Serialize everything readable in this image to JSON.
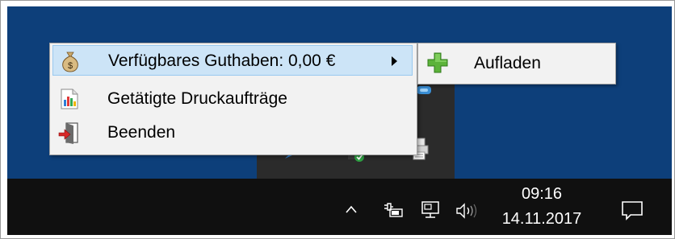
{
  "context_menu": {
    "items": [
      {
        "label": "Verfügbares Guthaben: 0,00 €",
        "icon": "money-bag-icon",
        "has_submenu": true,
        "selected": true
      },
      {
        "label": "Getätigte Druckaufträge",
        "icon": "bar-chart-document-icon",
        "has_submenu": false,
        "selected": false
      },
      {
        "label": "Beenden",
        "icon": "exit-door-icon",
        "has_submenu": false,
        "selected": false
      }
    ]
  },
  "submenu": {
    "items": [
      {
        "label": "Aufladen",
        "icon": "green-plus-icon"
      }
    ]
  },
  "taskbar": {
    "tray_icons": [
      "show-hidden-icons-chevron",
      "power-plug-battery-icon",
      "network-icon",
      "volume-icon"
    ],
    "time": "09:16",
    "date": "14.11.2017",
    "notification_icon": "action-center-icon"
  },
  "colors": {
    "desktop": "#0d3f7a",
    "taskbar": "#101010",
    "menu_background": "#f2f2f2",
    "menu_selected": "#cce4f7",
    "menu_selected_border": "#99c9ef"
  }
}
